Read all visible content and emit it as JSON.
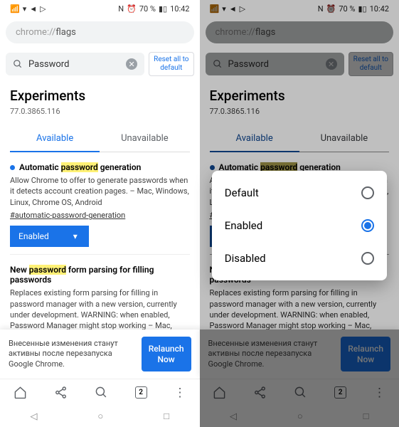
{
  "status": {
    "nfc": "N",
    "alarm": "⏰",
    "battery": "70 %",
    "time": "10:42"
  },
  "url": {
    "prefix": "chrome://",
    "path": "flags"
  },
  "search": {
    "value": "Password"
  },
  "reset": {
    "l1": "Reset all to",
    "l2": "default"
  },
  "title": "Experiments",
  "version": "77.0.3865.116",
  "tabs": {
    "available": "Available",
    "unavailable": "Unavailable"
  },
  "flag1": {
    "pre": "Automatic ",
    "hl": "password",
    "post": " generation",
    "desc": "Allow Chrome to offer to generate passwords when it detects account creation pages. – Mac, Windows, Linux, Chrome OS, Android",
    "link": "#automatic-password-generation",
    "select": "Enabled"
  },
  "flag2": {
    "pre": "New ",
    "hl": "password",
    "post": " form parsing for filling passwords",
    "desc": "Replaces existing form parsing for filling in password manager with a new version, currently under development. WARNING: when enabled, Password Manager might stop working – Mac, Windows, Linux,"
  },
  "relaunch": {
    "text": "Внесенные изменения станут активны после перезапуска Google Chrome.",
    "btn_l1": "Relaunch",
    "btn_l2": "Now"
  },
  "tabcount": "2",
  "dialog": {
    "default": "Default",
    "enabled": "Enabled",
    "disabled": "Disabled"
  }
}
